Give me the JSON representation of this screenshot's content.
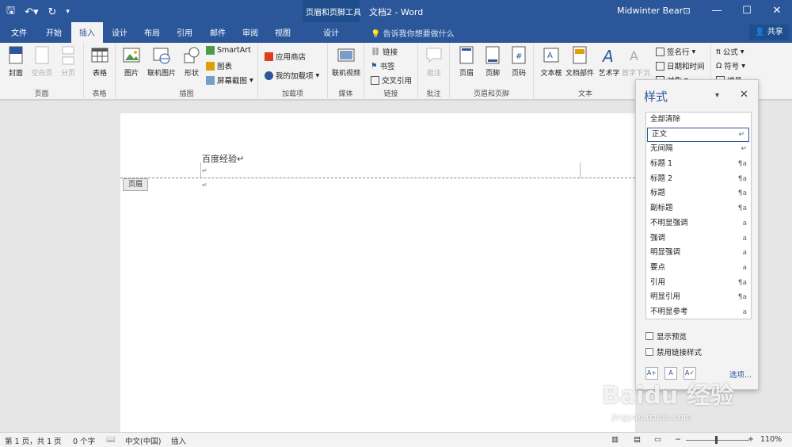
{
  "titlebar": {
    "context_title": "页眉和页脚工具",
    "doc_title": "文档2  -  Word",
    "user": "Midwinter Bear",
    "ribbon_opt": "⊡",
    "minimize": "—",
    "maximize": "☐",
    "close": "✕"
  },
  "tabs": [
    "文件",
    "开始",
    "插入",
    "设计",
    "布局",
    "引用",
    "邮件",
    "审阅",
    "视图"
  ],
  "context_tab": "设计",
  "tellme": "告诉我你想要做什么",
  "share": "共享",
  "ribbon": {
    "groups": {
      "pages": "页面",
      "tables": "表格",
      "illustrations": "插图",
      "addins": "加载项",
      "media": "媒体",
      "links": "链接",
      "comments": "批注",
      "header_footer": "页眉和页脚",
      "text": "文本"
    },
    "buttons": {
      "cover": "封面",
      "blank": "空白页",
      "break": "分页",
      "table": "表格",
      "picture": "图片",
      "online_picture": "联机图片",
      "shapes": "形状",
      "smartart": "SmartArt",
      "chart": "图表",
      "screenshot": "屏幕截图",
      "store": "应用商店",
      "my_addins": "我的加载项",
      "online_video": "联机视频",
      "link": "链接",
      "bookmark": "书签",
      "crossref": "交叉引用",
      "comment": "批注",
      "header": "页眉",
      "footer": "页脚",
      "page_number": "页码",
      "textbox": "文本框",
      "quickparts": "文档部件",
      "wordart": "艺术字",
      "dropcap": "首字下沉",
      "signature": "签名行",
      "datetime": "日期和时间",
      "object": "对象",
      "equation": "公式",
      "symbol": "符号",
      "numbering": "编号"
    }
  },
  "document": {
    "header_text": "百度经验↵",
    "para_mark": "↵",
    "header_tag": "页眉"
  },
  "styles_pane": {
    "title": "样式",
    "menu": "▾",
    "close": "✕",
    "items": [
      {
        "name": "全部清除",
        "mark": ""
      },
      {
        "name": "正文",
        "mark": "↵"
      },
      {
        "name": "无间隔",
        "mark": "↵"
      },
      {
        "name": "标题 1",
        "mark": "¶a"
      },
      {
        "name": "标题 2",
        "mark": "¶a"
      },
      {
        "name": "标题",
        "mark": "¶a"
      },
      {
        "name": "副标题",
        "mark": "¶a"
      },
      {
        "name": "不明显强调",
        "mark": "a"
      },
      {
        "name": "强调",
        "mark": "a"
      },
      {
        "name": "明显强调",
        "mark": "a"
      },
      {
        "name": "要点",
        "mark": "a"
      },
      {
        "name": "引用",
        "mark": "¶a"
      },
      {
        "name": "明显引用",
        "mark": "¶a"
      },
      {
        "name": "不明显参考",
        "mark": "a"
      }
    ],
    "show_preview": "显示预览",
    "disable_linked": "禁用链接样式",
    "options": "选项..."
  },
  "statusbar": {
    "page": "第 1 页，共 1 页",
    "words": "0 个字",
    "lang": "中文(中国)",
    "mode": "插入",
    "zoom": "110%"
  },
  "watermark": {
    "main": "Baidu 经验",
    "sub": "jingyan.baidu.com"
  }
}
